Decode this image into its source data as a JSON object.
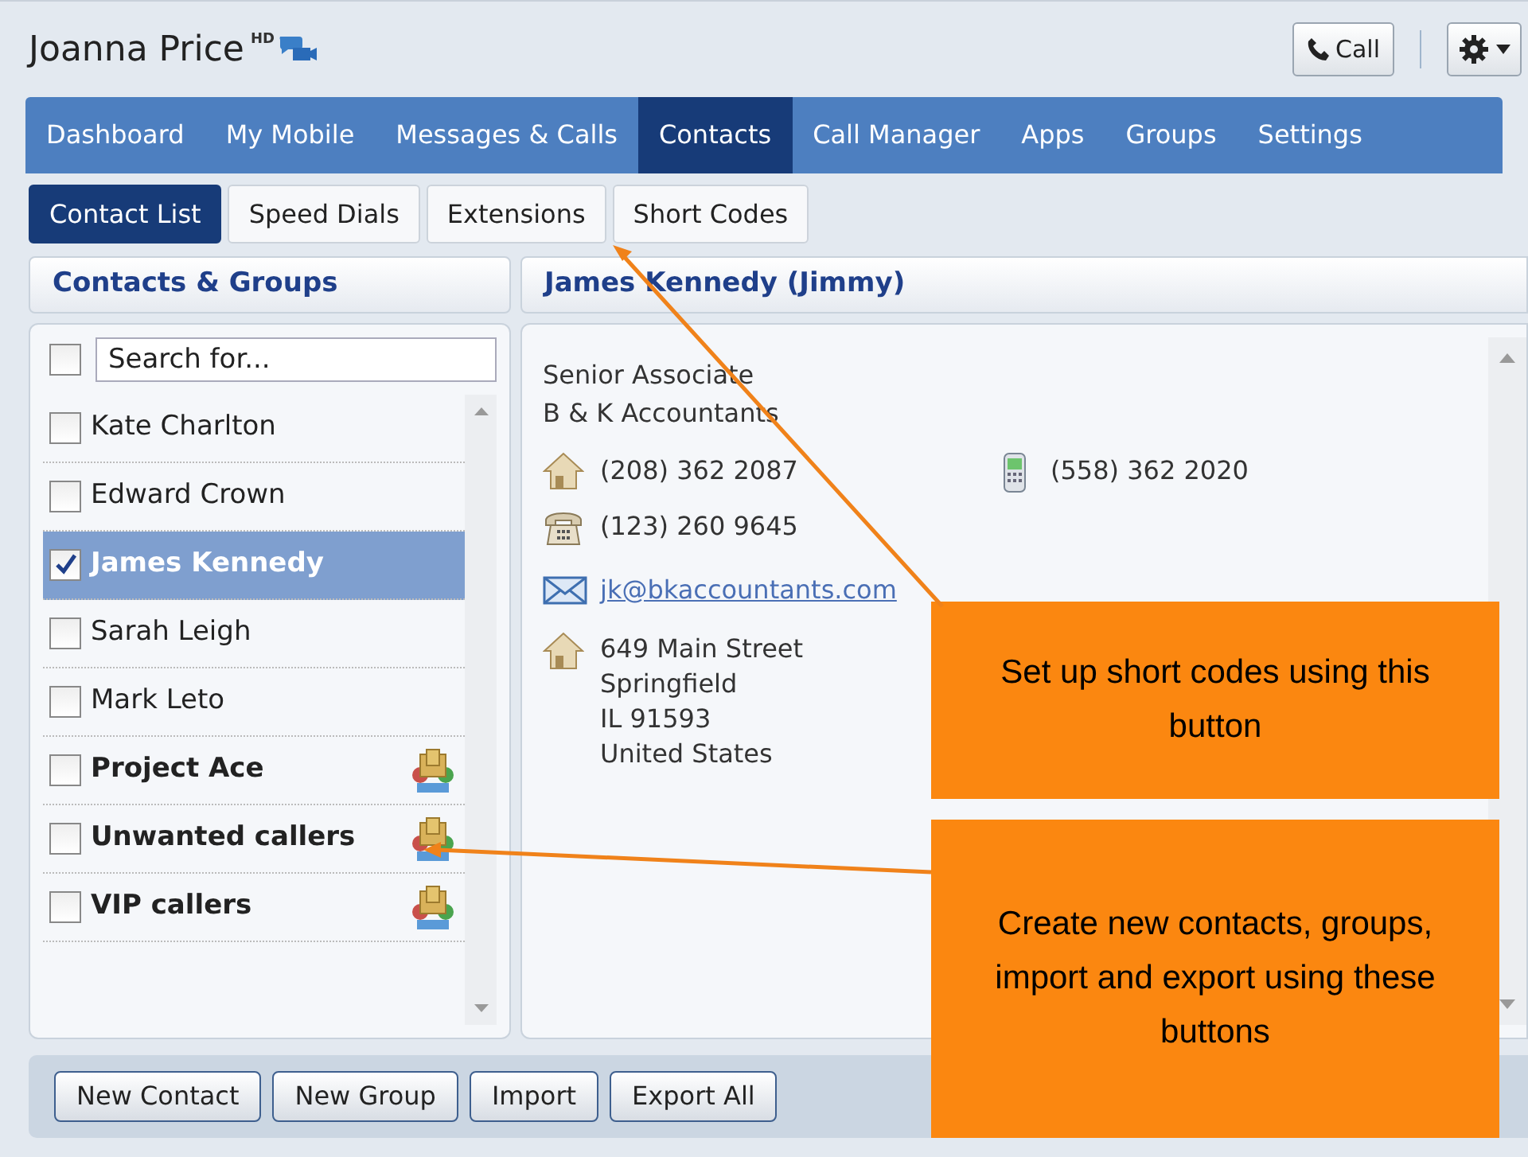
{
  "header": {
    "user_name": "Joanna Price",
    "hd_badge": "HD",
    "call_button": "Call"
  },
  "nav_tabs": [
    {
      "label": "Dashboard",
      "selected": false
    },
    {
      "label": "My Mobile",
      "selected": false
    },
    {
      "label": "Messages & Calls",
      "selected": false
    },
    {
      "label": "Contacts",
      "selected": true
    },
    {
      "label": "Call Manager",
      "selected": false
    },
    {
      "label": "Apps",
      "selected": false
    },
    {
      "label": "Groups",
      "selected": false
    },
    {
      "label": "Settings",
      "selected": false
    }
  ],
  "sub_tabs": [
    {
      "label": "Contact List",
      "selected": true
    },
    {
      "label": "Speed Dials",
      "selected": false
    },
    {
      "label": "Extensions",
      "selected": false
    },
    {
      "label": "Short Codes",
      "selected": false
    }
  ],
  "contacts_panel": {
    "title": "Contacts & Groups",
    "search": {
      "placeholder": "Search for...",
      "select_all_checked": false
    },
    "items": [
      {
        "name": "Kate Charlton",
        "kind": "contact",
        "checked": false,
        "selected": false
      },
      {
        "name": "Edward Crown",
        "kind": "contact",
        "checked": false,
        "selected": false
      },
      {
        "name": "James Kennedy",
        "kind": "contact",
        "checked": true,
        "selected": true
      },
      {
        "name": "Sarah Leigh",
        "kind": "contact",
        "checked": false,
        "selected": false
      },
      {
        "name": "Mark Leto",
        "kind": "contact",
        "checked": false,
        "selected": false
      },
      {
        "name": "Project Ace",
        "kind": "group",
        "checked": false,
        "selected": false
      },
      {
        "name": "Unwanted callers",
        "kind": "group",
        "checked": false,
        "selected": false
      },
      {
        "name": "VIP callers",
        "kind": "group",
        "checked": false,
        "selected": false
      }
    ]
  },
  "detail_panel": {
    "title": "James Kennedy (Jimmy)",
    "job_title": "Senior Associate",
    "company": "B & K Accountants",
    "phones": [
      {
        "kind": "home",
        "number": "(208) 362 2087"
      },
      {
        "kind": "mobile",
        "number": "(558) 362 2020"
      },
      {
        "kind": "landline",
        "number": "(123) 260 9645"
      }
    ],
    "email": "jk@bkaccountants.com",
    "address": [
      "649 Main Street",
      "Springfield",
      "IL 91593",
      "United States"
    ]
  },
  "footer_buttons": [
    "New Contact",
    "New Group",
    "Import",
    "Export All"
  ],
  "callouts": [
    {
      "text": "Set up short codes using this button"
    },
    {
      "text": "Create new contacts, groups, import and export using these buttons"
    }
  ]
}
